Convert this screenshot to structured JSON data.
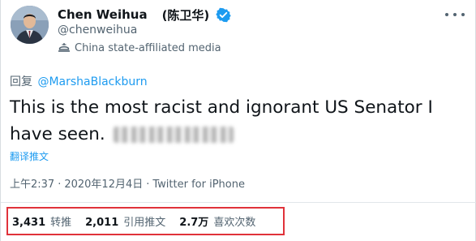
{
  "user": {
    "name": "Chen Weihua",
    "name_cn": "(陈卫华)",
    "handle": "@chenweihua",
    "affiliation": "China state-affiliated media"
  },
  "tweet": {
    "reply_prefix": "回复",
    "reply_to": "@MarshaBlackburn",
    "text": "This is the most racist and ignorant US Senator I have seen.",
    "translate_label": "翻译推文",
    "time": "上午2:37",
    "date": "2020年12月4日",
    "source": "Twitter for iPhone",
    "separator": "·"
  },
  "stats": {
    "retweets_count": "3,431",
    "retweets_label": "转推",
    "quotes_count": "2,011",
    "quotes_label": "引用推文",
    "likes_count": "2.7万",
    "likes_label": "喜欢次数"
  },
  "icons": {
    "verified": "verified-badge-icon",
    "affiliation": "state-media-icon",
    "more": "more-icon"
  },
  "colors": {
    "accent": "#1d9bf0",
    "highlight_box": "#e0323a",
    "secondary_text": "#536471"
  }
}
